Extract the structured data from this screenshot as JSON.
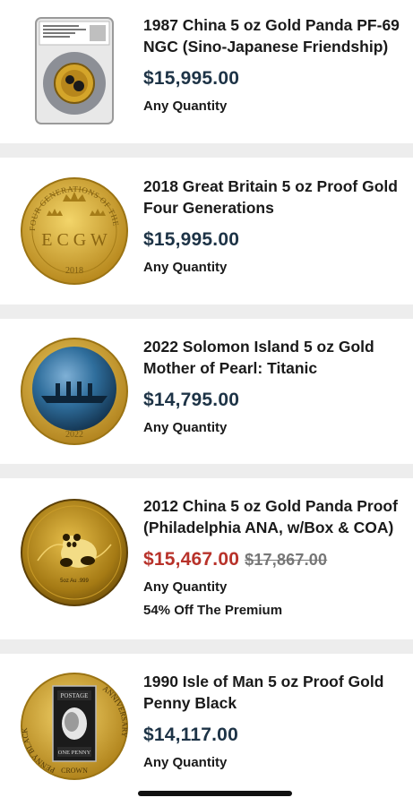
{
  "products": [
    {
      "title": "1987 China 5 oz Gold Panda PF-69 NGC (Sino-Japanese Friendship)",
      "price": "$15,995.00",
      "quantity": "Any Quantity"
    },
    {
      "title": "2018 Great Britain 5 oz Proof Gold Four Generations",
      "price": "$15,995.00",
      "quantity": "Any Quantity",
      "coin_text": {
        "arc": "FOUR GENERATIONS OF THE ROYAL FAMILY",
        "monogram": "E C G W",
        "year": "2018"
      }
    },
    {
      "title": "2022 Solomon Island 5 oz Gold Mother of Pearl: Titanic",
      "price": "$14,795.00",
      "quantity": "Any Quantity",
      "coin_text": {
        "year": "2022"
      }
    },
    {
      "title": "2012 China 5 oz Gold Panda Proof (Philadelphia ANA, w/Box & COA)",
      "price": "$15,467.00",
      "old_price": "$17,867.00",
      "quantity": "Any Quantity",
      "promo": "54% Off The Premium",
      "coin_text": {
        "inscription": "5oz Au .999"
      }
    },
    {
      "title": "1990 Isle of Man 5 oz Proof Gold Penny Black",
      "price": "$14,117.00",
      "quantity": "Any Quantity",
      "coin_text": {
        "left": "PENNY BLACK",
        "right": "ANNIVERSARY",
        "bottom": "CROWN",
        "stamp_top": "POSTAGE",
        "stamp_bottom": "ONE PENNY"
      }
    }
  ],
  "colors": {
    "price": "#1d3346",
    "sale_price": "#b8322a",
    "old_price": "#777777",
    "gold": "#c9a227",
    "background": "#ededed"
  }
}
